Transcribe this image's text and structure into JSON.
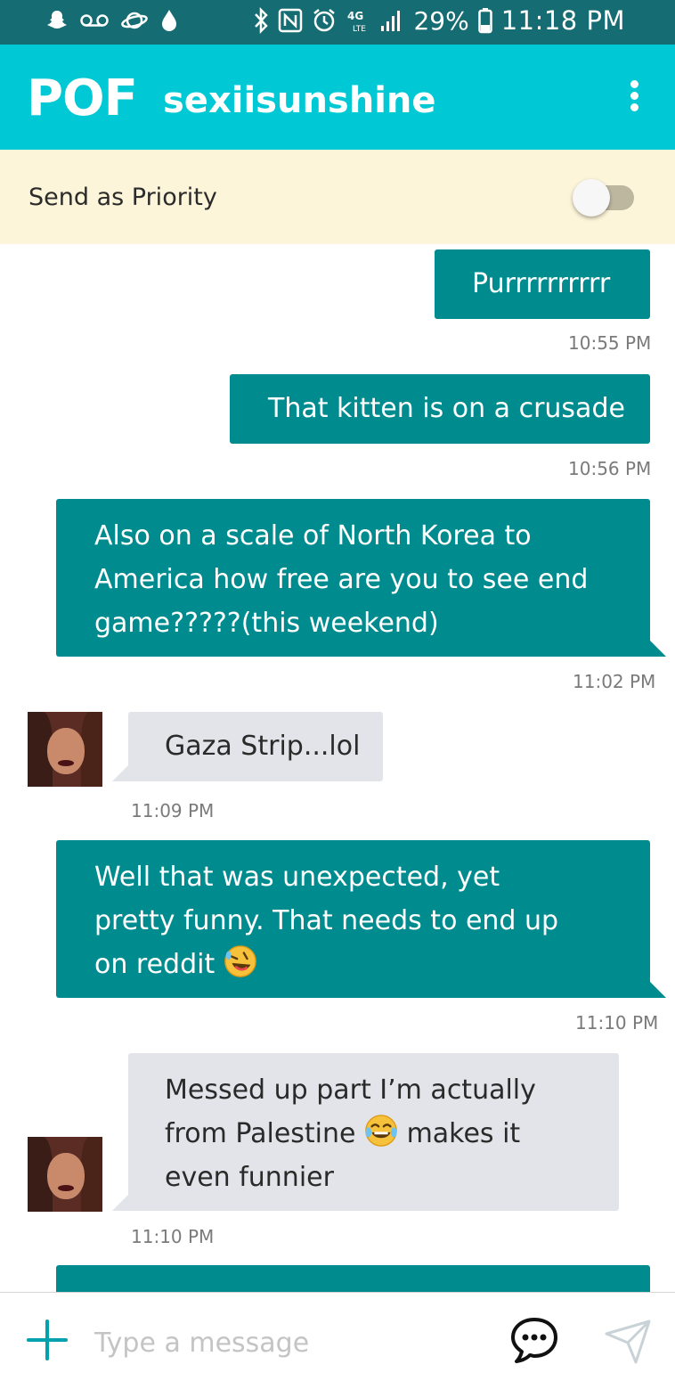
{
  "status_bar": {
    "battery": "29%",
    "time": "11:18 PM",
    "network": "4G LTE",
    "left_icons": [
      "snapchat-icon",
      "voicemail-icon",
      "saturn-icon",
      "drop-icon"
    ],
    "right_icons": [
      "bluetooth-icon",
      "nfc-icon",
      "alarm-icon",
      "lte-icon",
      "signal-icon",
      "battery-icon"
    ]
  },
  "header": {
    "logo": "POF",
    "chat_name": "sexiisunshine",
    "menu_icon": "more-vert-icon"
  },
  "priority": {
    "label": "Send as Priority",
    "enabled": false
  },
  "messages": [
    {
      "direction": "out",
      "text": "Purrrrrrrrrr",
      "time": "10:55 PM"
    },
    {
      "direction": "out",
      "text": "That kitten is on a crusade",
      "time": "10:56 PM"
    },
    {
      "direction": "out",
      "lines": [
        "Also on a scale of North Korea to",
        "America how free are you to see end",
        "game?????(this weekend)"
      ],
      "time": "11:02 PM"
    },
    {
      "direction": "in",
      "text": "Gaza Strip...lol",
      "time": "11:09 PM"
    },
    {
      "direction": "out",
      "lines": [
        "Well that was unexpected, yet",
        "pretty funny. That needs to end up",
        "on reddit"
      ],
      "emoji": "rolling-on-floor-laughing-emoji",
      "time": "11:10 PM"
    },
    {
      "direction": "in",
      "lines": [
        "Messed up part I’m actually",
        "from Palestine",
        "makes it",
        "even funnier"
      ],
      "emoji": "tears-of-joy-emoji",
      "time": "11:10 PM"
    }
  ],
  "input": {
    "placeholder": "Type a message",
    "value": ""
  },
  "colors": {
    "status_bar": "#156c72",
    "header": "#00c8d4",
    "priority_bg": "#fdf5d9",
    "outgoing": "#008b8f",
    "incoming": "#e2e4e9"
  }
}
